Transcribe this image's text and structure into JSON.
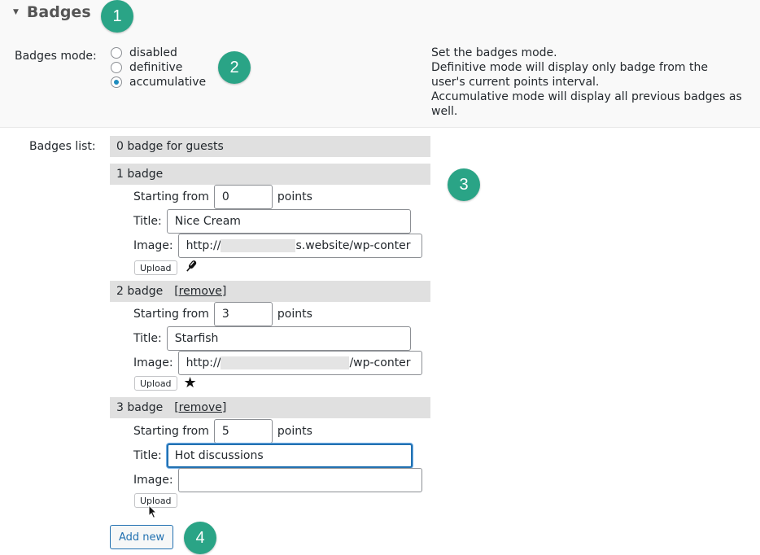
{
  "section": {
    "title": "Badges",
    "marker": "1"
  },
  "mode": {
    "label": "Badges mode:",
    "marker": "2",
    "options": [
      {
        "label": "disabled",
        "checked": false
      },
      {
        "label": "definitive",
        "checked": false
      },
      {
        "label": "accumulative",
        "checked": true
      }
    ],
    "description": [
      "Set the badges mode.",
      "Definitive mode will display only badge from the",
      "user's current points interval.",
      "Accumulative mode will display all previous badges as",
      "well."
    ]
  },
  "list": {
    "label": "Badges list:",
    "marker": "3",
    "guest_badge": "0 badge for guests",
    "starting_from_label": "Starting from",
    "points_label": "points",
    "title_label": "Title:",
    "image_label": "Image:",
    "upload_label": "Upload",
    "remove_label": "[remove]",
    "badges": [
      {
        "header": "1 badge",
        "start": "0",
        "title": "Nice Cream",
        "image_prefix": "http://",
        "image_suffix": "s.website/wp-conter",
        "icon": "popsicle-icon"
      },
      {
        "header": "2 badge",
        "start": "3",
        "title": "Starfish",
        "image_prefix": "http://",
        "image_suffix": "/wp-conter",
        "icon": "star-icon"
      },
      {
        "header": "3 badge",
        "start": "5",
        "title": "Hot discussions",
        "image_prefix": "",
        "image_suffix": "",
        "icon": ""
      }
    ],
    "add_new_label": "Add new",
    "add_marker": "4"
  }
}
